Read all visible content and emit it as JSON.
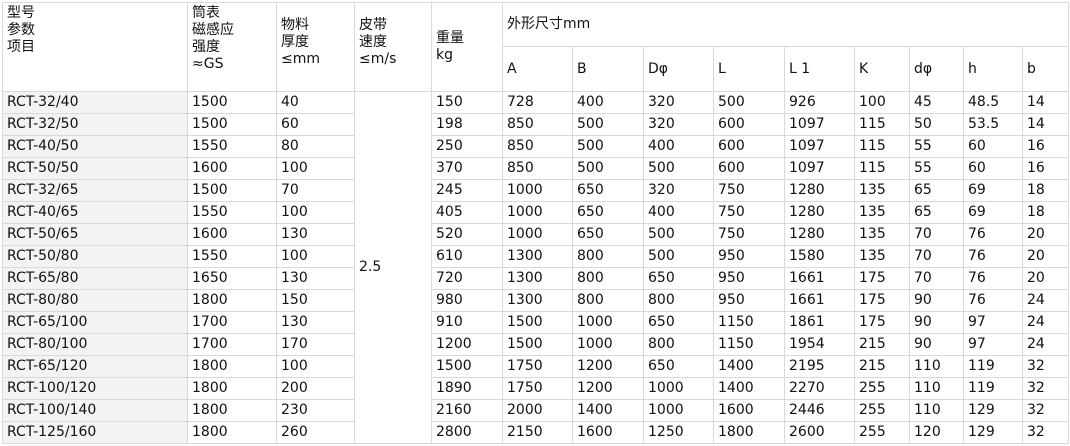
{
  "header": {
    "model_label": [
      "型号",
      "参数",
      "项目"
    ],
    "field_strength": [
      "筒表",
      "磁感应",
      "强度",
      "≈GS"
    ],
    "material_thickness": [
      "物料",
      "厚度",
      "≤mm"
    ],
    "belt_speed": [
      "皮带",
      "速度",
      "≤m/s"
    ],
    "weight": [
      "重量",
      "kg"
    ],
    "dimensions_group": "外形尺寸mm",
    "dimension_cols": [
      "A",
      "B",
      "Dφ",
      "L",
      "L 1",
      "K",
      "dφ",
      "h",
      "b"
    ]
  },
  "belt_speed_value": "2.5",
  "rows": [
    [
      "RCT-32/40",
      "1500",
      "40",
      "150",
      "728",
      "400",
      "320",
      "500",
      "926",
      "100",
      "45",
      "48.5",
      "14"
    ],
    [
      "RCT-32/50",
      "1500",
      "60",
      "198",
      "850",
      "500",
      "320",
      "600",
      "1097",
      "115",
      "50",
      "53.5",
      "14"
    ],
    [
      "RCT-40/50",
      "1550",
      "80",
      "250",
      "850",
      "500",
      "400",
      "600",
      "1097",
      "115",
      "55",
      "60",
      "16"
    ],
    [
      "RCT-50/50",
      "1600",
      "100",
      "370",
      "850",
      "500",
      "500",
      "600",
      "1097",
      "115",
      "55",
      "60",
      "16"
    ],
    [
      "RCT-32/65",
      "1500",
      "70",
      "245",
      "1000",
      "650",
      "320",
      "750",
      "1280",
      "135",
      "65",
      "69",
      "18"
    ],
    [
      "RCT-40/65",
      "1550",
      "100",
      "405",
      "1000",
      "650",
      "400",
      "750",
      "1280",
      "135",
      "65",
      "69",
      "18"
    ],
    [
      "RCT-50/65",
      "1600",
      "130",
      "520",
      "1000",
      "650",
      "500",
      "750",
      "1280",
      "135",
      "70",
      "76",
      "20"
    ],
    [
      "RCT-50/80",
      "1550",
      "100",
      "610",
      "1300",
      "800",
      "500",
      "950",
      "1580",
      "135",
      "70",
      "76",
      "20"
    ],
    [
      "RCT-65/80",
      "1650",
      "130",
      "720",
      "1300",
      "800",
      "650",
      "950",
      "1661",
      "175",
      "70",
      "76",
      "20"
    ],
    [
      "RCT-80/80",
      "1800",
      "150",
      "980",
      "1300",
      "800",
      "800",
      "950",
      "1661",
      "175",
      "90",
      "76",
      "24"
    ],
    [
      "RCT-65/100",
      "1700",
      "130",
      "910",
      "1500",
      "1000",
      "650",
      "1150",
      "1861",
      "175",
      "90",
      "97",
      "24"
    ],
    [
      "RCT-80/100",
      "1700",
      "170",
      "1200",
      "1500",
      "1000",
      "800",
      "1150",
      "1954",
      "215",
      "90",
      "97",
      "24"
    ],
    [
      "RCT-65/120",
      "1800",
      "100",
      "1500",
      "1750",
      "1200",
      "650",
      "1400",
      "2195",
      "215",
      "110",
      "119",
      "32"
    ],
    [
      "RCT-100/120",
      "1800",
      "200",
      "1890",
      "1750",
      "1200",
      "1000",
      "1400",
      "2270",
      "255",
      "110",
      "119",
      "32"
    ],
    [
      "RCT-100/140",
      "1800",
      "230",
      "2160",
      "2000",
      "1400",
      "1000",
      "1600",
      "2446",
      "255",
      "110",
      "129",
      "32"
    ],
    [
      "RCT-125/160",
      "1800",
      "260",
      "2800",
      "2150",
      "1600",
      "1250",
      "1800",
      "2600",
      "255",
      "120",
      "129",
      "32"
    ]
  ]
}
